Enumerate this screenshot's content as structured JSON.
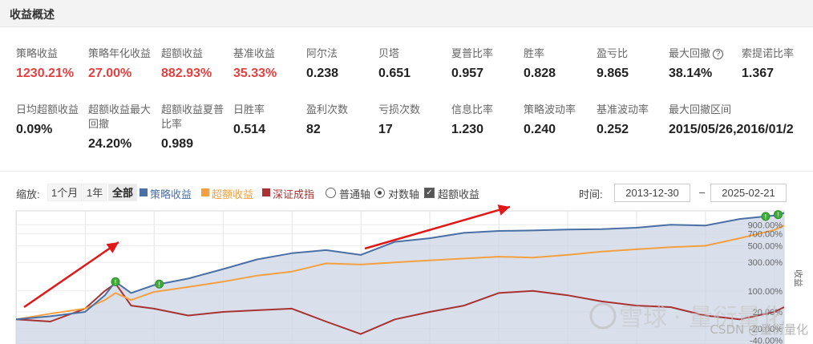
{
  "header": {
    "title": "收益概述"
  },
  "metrics": [
    {
      "label": "策略收益",
      "value": "1230.21%",
      "color": "red"
    },
    {
      "label": "策略年化收益",
      "value": "27.00%",
      "color": "red"
    },
    {
      "label": "超额收益",
      "value": "882.93%",
      "color": "red"
    },
    {
      "label": "基准收益",
      "value": "35.33%",
      "color": "red"
    },
    {
      "label": "阿尔法",
      "value": "0.238",
      "color": "black"
    },
    {
      "label": "贝塔",
      "value": "0.651",
      "color": "black"
    },
    {
      "label": "夏普比率",
      "value": "0.957",
      "color": "black"
    },
    {
      "label": "胜率",
      "value": "0.828",
      "color": "black"
    },
    {
      "label": "盈亏比",
      "value": "9.865",
      "color": "black"
    },
    {
      "label": "最大回撤",
      "value": "38.14%",
      "color": "black",
      "help_icon": "question-circle-icon"
    },
    {
      "label": "索提诺比率",
      "value": "1.367",
      "color": "black"
    },
    {
      "label": "日均超额收益",
      "value": "0.09%",
      "color": "black"
    },
    {
      "label": "超额收益最大回撤",
      "value": "24.20%",
      "color": "black"
    },
    {
      "label": "超额收益夏普比率",
      "value": "0.989",
      "color": "black"
    },
    {
      "label": "日胜率",
      "value": "0.514",
      "color": "black"
    },
    {
      "label": "盈利次数",
      "value": "82",
      "color": "black"
    },
    {
      "label": "亏损次数",
      "value": "17",
      "color": "black"
    },
    {
      "label": "信息比率",
      "value": "1.230",
      "color": "black"
    },
    {
      "label": "策略波动率",
      "value": "0.240",
      "color": "black"
    },
    {
      "label": "基准波动率",
      "value": "0.252",
      "color": "black"
    },
    {
      "label": "最大回撤区间",
      "value": "2015/05/26,2016/01/2",
      "color": "black"
    }
  ],
  "controls": {
    "zoom_label": "缩放:",
    "ranges": [
      "1个月",
      "1年",
      "全部"
    ],
    "active_range": "全部",
    "legend": [
      {
        "name": "策略收益",
        "color": "#4a6fa5"
      },
      {
        "name": "超额收益",
        "color": "#f5a040"
      },
      {
        "name": "深证成指",
        "color": "#a83232"
      }
    ],
    "axis_options": [
      "普通轴",
      "对数轴"
    ],
    "selected_axis": "对数轴",
    "excess_checkbox": "超额收益",
    "excess_checked": true,
    "time_label": "时间:",
    "start_date": "2013-12-30",
    "end_date": "2025-02-21",
    "dash": "–"
  },
  "chart_data": {
    "type": "line",
    "log_scale": true,
    "x_range": [
      "2013-12-30",
      "2025-02-21"
    ],
    "y_ticks": [
      "900.00%",
      "700.00%",
      "500.00%",
      "300.00%",
      "100.00%",
      "20.00%",
      "-20.00%",
      "-40.00%"
    ],
    "y_axis_title": "收益",
    "series": [
      {
        "name": "策略收益",
        "color": "#4a6fa5",
        "area": true,
        "x": [
          "2013-12-30",
          "2014-06-30",
          "2014-12-31",
          "2015-04-15",
          "2015-06-10",
          "2015-09-01",
          "2015-12-31",
          "2016-06-30",
          "2016-12-31",
          "2017-06-30",
          "2017-12-31",
          "2018-06-30",
          "2018-12-31",
          "2019-06-30",
          "2019-12-31",
          "2020-06-30",
          "2020-12-31",
          "2021-06-30",
          "2021-12-31",
          "2022-06-30",
          "2022-12-31",
          "2023-06-30",
          "2023-12-31",
          "2024-06-30",
          "2024-12-31",
          "2025-02-21"
        ],
        "values": [
          0,
          8,
          20,
          80,
          150,
          90,
          130,
          170,
          240,
          330,
          400,
          440,
          380,
          560,
          620,
          720,
          760,
          770,
          790,
          800,
          830,
          900,
          880,
          1050,
          1150,
          1230
        ]
      },
      {
        "name": "超额收益",
        "color": "#f5a040",
        "area": false,
        "x": [
          "2013-12-30",
          "2014-06-30",
          "2014-12-31",
          "2015-04-15",
          "2015-06-10",
          "2015-09-01",
          "2015-12-31",
          "2016-06-30",
          "2016-12-31",
          "2017-06-30",
          "2017-12-31",
          "2018-06-30",
          "2018-12-31",
          "2019-06-30",
          "2019-12-31",
          "2020-06-30",
          "2020-12-31",
          "2021-06-30",
          "2021-12-31",
          "2022-06-30",
          "2022-12-31",
          "2023-06-30",
          "2023-12-31",
          "2024-06-30",
          "2024-12-31",
          "2025-02-21"
        ],
        "values": [
          0,
          15,
          30,
          60,
          90,
          60,
          95,
          120,
          150,
          190,
          220,
          290,
          280,
          300,
          320,
          340,
          360,
          350,
          380,
          420,
          450,
          480,
          500,
          620,
          780,
          883
        ]
      },
      {
        "name": "深证成指",
        "color": "#a83232",
        "area": false,
        "x": [
          "2013-12-30",
          "2014-06-30",
          "2014-12-31",
          "2015-04-15",
          "2015-06-10",
          "2015-09-01",
          "2015-12-31",
          "2016-06-30",
          "2016-12-31",
          "2017-06-30",
          "2017-12-31",
          "2018-06-30",
          "2018-12-31",
          "2019-06-30",
          "2019-12-31",
          "2020-06-30",
          "2020-12-31",
          "2021-06-30",
          "2021-12-31",
          "2022-06-30",
          "2022-12-31",
          "2023-06-30",
          "2023-12-31",
          "2024-06-30",
          "2024-12-31",
          "2025-02-21"
        ],
        "values": [
          0,
          -5,
          30,
          100,
          140,
          40,
          30,
          10,
          20,
          25,
          30,
          -5,
          -30,
          0,
          20,
          40,
          90,
          100,
          80,
          55,
          40,
          35,
          10,
          0,
          20,
          35
        ]
      }
    ],
    "markers": [
      {
        "date": "2015-06-10",
        "series": "策略收益",
        "label": "!"
      },
      {
        "date": "2016-01-28",
        "series": "策略收益",
        "label": "!"
      },
      {
        "date": "2024-11-15",
        "series": "策略收益",
        "label": "!"
      },
      {
        "date": "2025-01-20",
        "series": "策略收益",
        "label": "!"
      }
    ]
  },
  "watermark": {
    "brand": "雪球",
    "author": "量衍量化",
    "source": "CSDN @量衍量化"
  }
}
